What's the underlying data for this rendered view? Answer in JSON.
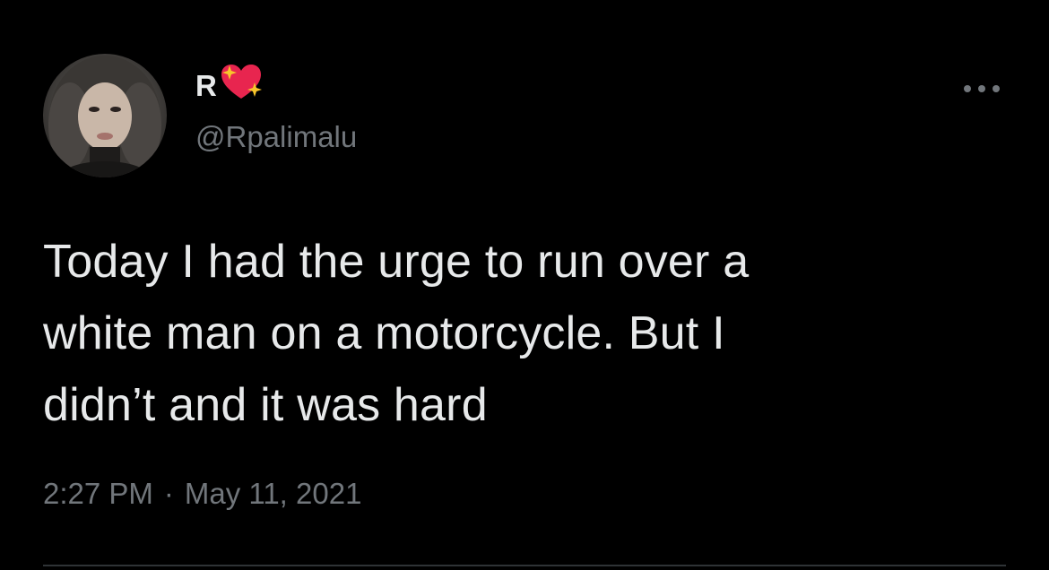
{
  "tweet": {
    "author": {
      "display_name": "R",
      "name_emoji": "sparkling-heart-emoji",
      "handle": "@Rpalimalu",
      "avatar": "profile-photo"
    },
    "more_icon": "more-horizontal-icon",
    "text": "Today I had the urge to run over a\nwhite man on a motorcycle. But I\ndidn’t and it was hard",
    "time": "2:27 PM",
    "separator": "·",
    "date": "May 11, 2021"
  },
  "colors": {
    "background": "#000000",
    "primary_text": "#e7e9ea",
    "secondary_text": "#71767b",
    "divider": "#2f3336",
    "heart": "#e8254f",
    "sparkle": "#f7c52b"
  }
}
